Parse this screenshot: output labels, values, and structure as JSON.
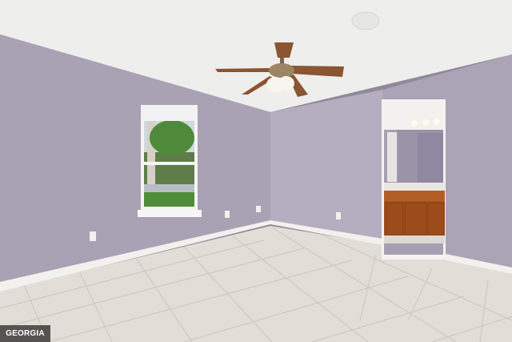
{
  "watermark": {
    "text": "GEORGIA MLS"
  },
  "colors": {
    "ceiling": "#eeeeec",
    "wall_left": "#a8a2b4",
    "wall_back": "#b4aec0",
    "wall_right": "#aaa4b6",
    "floor": "#e2ddd6",
    "baseboard": "#f3f1ee",
    "cabinet": "#a8541e",
    "fan_blade": "#8a5530"
  }
}
